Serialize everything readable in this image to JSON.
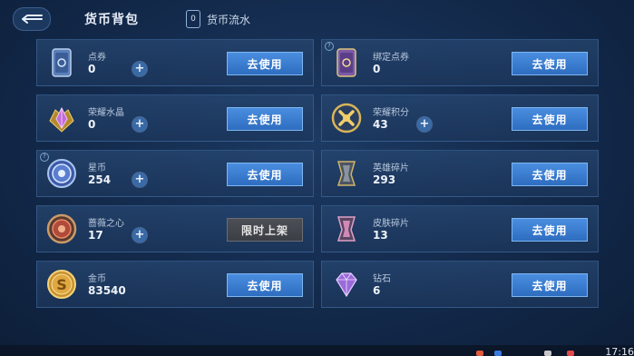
{
  "header": {
    "title": "货币背包",
    "flow_label": "货币流水",
    "flow_icon_glyph": "0"
  },
  "currencies": [
    {
      "label": "点券",
      "value": "0",
      "button": "去使用",
      "icon": "ticket-card-icon"
    },
    {
      "label": "绑定点券",
      "value": "0",
      "button": "去使用",
      "icon": "bound-ticket-card-icon"
    },
    {
      "label": "荣耀水晶",
      "value": "0",
      "button": "去使用",
      "icon": "glory-crystal-icon"
    },
    {
      "label": "荣耀积分",
      "value": "43",
      "button": "去使用",
      "icon": "glory-points-icon"
    },
    {
      "label": "星币",
      "value": "254",
      "button": "去使用",
      "icon": "star-coin-icon"
    },
    {
      "label": "英雄碎片",
      "value": "293",
      "button": "去使用",
      "icon": "hero-fragment-icon"
    },
    {
      "label": "蔷薇之心",
      "value": "17",
      "button": "限时上架",
      "icon": "rose-heart-icon"
    },
    {
      "label": "皮肤碎片",
      "value": "13",
      "button": "去使用",
      "icon": "skin-fragment-icon"
    },
    {
      "label": "金币",
      "value": "83540",
      "button": "去使用",
      "icon": "gold-coin-icon"
    },
    {
      "label": "钻石",
      "value": "6",
      "button": "去使用",
      "icon": "diamond-icon"
    }
  ],
  "status_bar": {
    "clock": "17:16"
  },
  "colors": {
    "accent_button": "#3f86da",
    "disabled_button": "#44474d",
    "background": "#142c4f"
  }
}
